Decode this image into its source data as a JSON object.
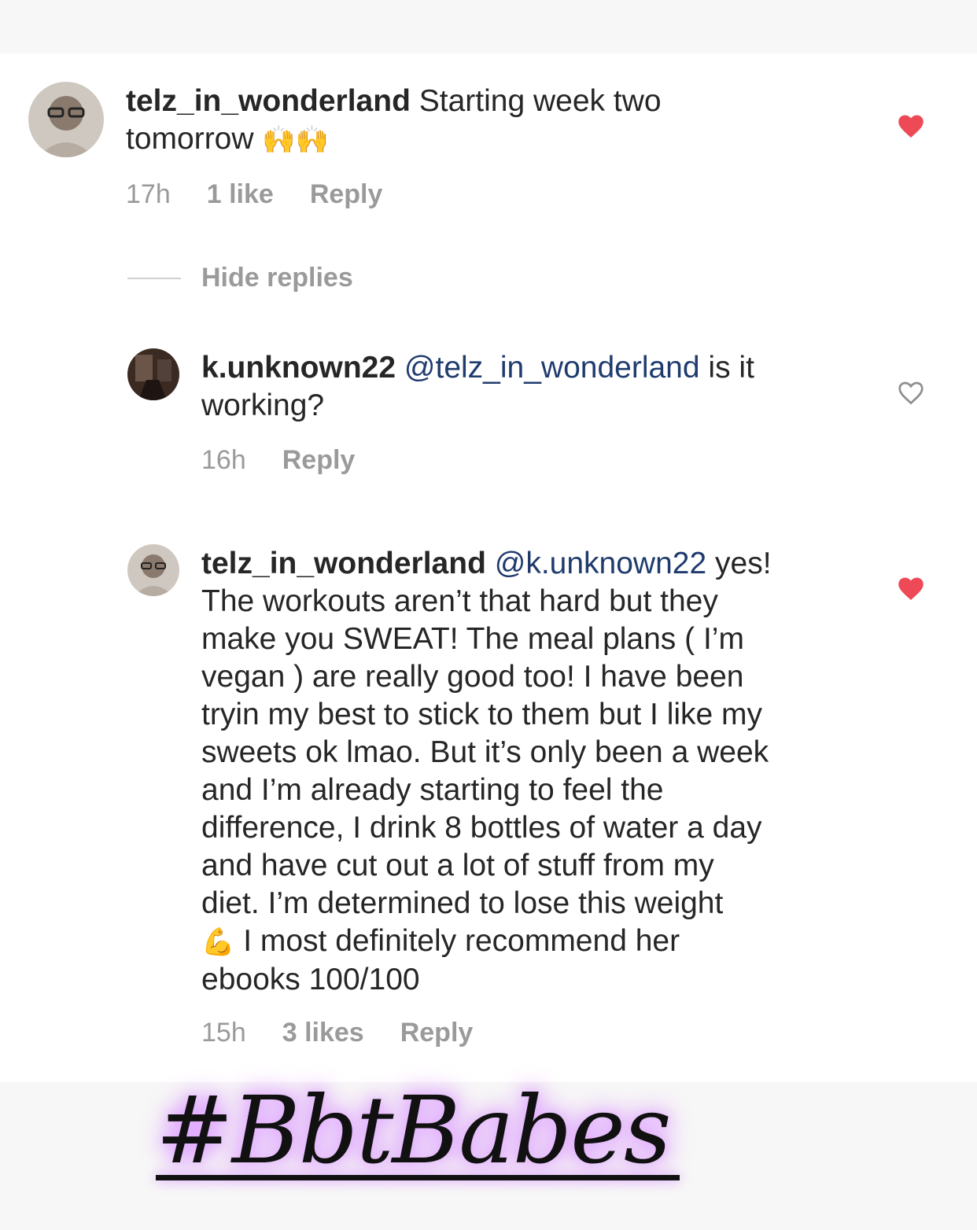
{
  "comments": [
    {
      "username": "telz_in_wonderland",
      "text_a": "Starting week two",
      "text_b": "tomorrow",
      "emoji": "🙌🙌",
      "time": "17h",
      "likes": "1 like",
      "reply_label": "Reply",
      "liked": true
    },
    {
      "username": "k.unknown22",
      "mention": "@telz_in_wonderland",
      "text_a": "is it",
      "text_b": "working?",
      "time": "16h",
      "reply_label": "Reply",
      "liked": false
    },
    {
      "username": "telz_in_wonderland",
      "mention": "@k.unknown22",
      "text_first": "yes!",
      "lines": [
        "The workouts aren’t that hard but they",
        "make you SWEAT! The meal plans ( I’m",
        "vegan ) are really good too! I have been",
        "tryin my best to stick to them but I like my",
        "sweets ok lmao. But it’s only been a week",
        "and I’m already starting to feel the",
        "difference, I drink 8 bottles of water a day",
        "and have cut out a lot of stuff from my",
        "diet. I’m determined to lose this weight"
      ],
      "emoji": "💪",
      "line_after_emoji": "I most definitely recommend her",
      "last_line": "ebooks 100/100",
      "time": "15h",
      "likes": "3 likes",
      "reply_label": "Reply",
      "liked": true
    }
  ],
  "hide_replies_label": "Hide replies",
  "hashtag": "#BbtBabes",
  "colors": {
    "heart_liked": "#ed4956",
    "heart_outline": "#8e8e8e",
    "mention": "#1f3b6e",
    "meta_gray": "#9a9a9a",
    "glow": "#d38cff"
  },
  "icons": {
    "liked": "heart-filled-icon",
    "unliked": "heart-outline-icon"
  }
}
